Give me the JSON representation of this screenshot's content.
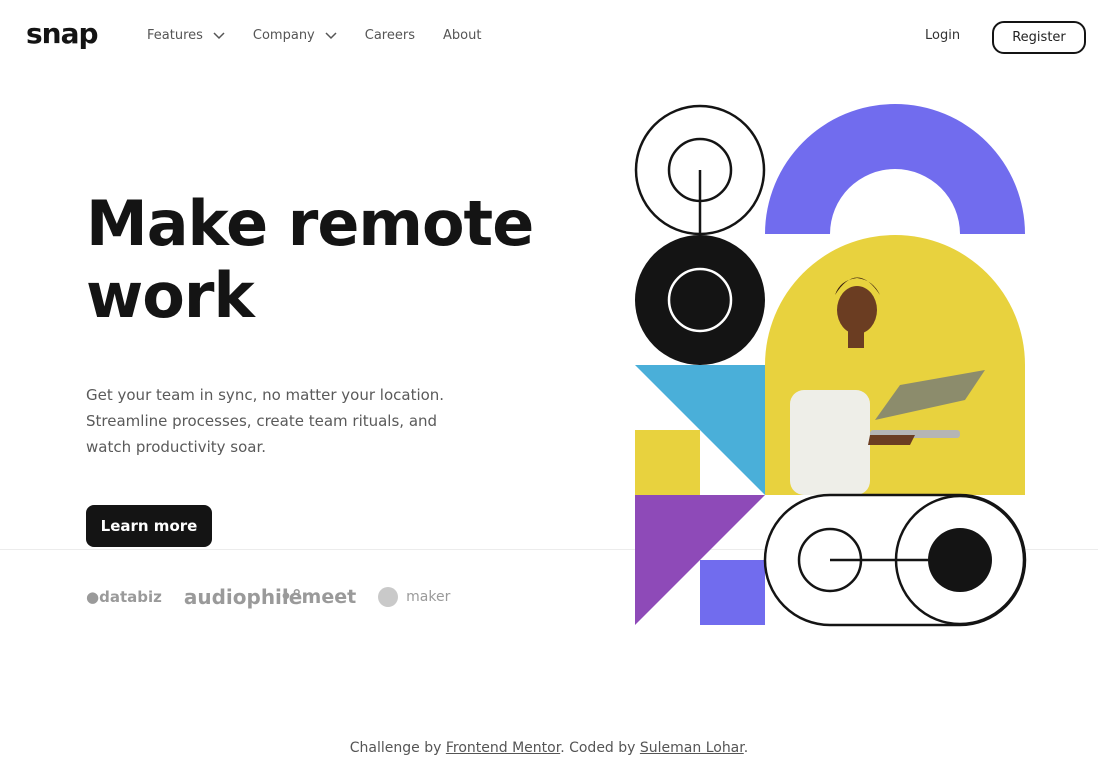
{
  "header": {
    "logo": "snap",
    "nav": [
      {
        "label": "Features",
        "has_dropdown": true
      },
      {
        "label": "Company",
        "has_dropdown": true
      },
      {
        "label": "Careers",
        "has_dropdown": false
      },
      {
        "label": "About",
        "has_dropdown": false
      }
    ],
    "login_label": "Login",
    "register_label": "Register"
  },
  "hero": {
    "headline": "Make remote work",
    "subtext": "Get your team in sync, no matter your location. Streamline processes, create team rituals, and watch productivity soar.",
    "cta_label": "Learn more"
  },
  "clients": [
    "databiz",
    "audiophile",
    "meet",
    "maker"
  ],
  "footer": {
    "prefix": "Challenge by ",
    "link1": "Frontend Mentor",
    "middle": ". Coded by ",
    "link2": "Suleman Lohar",
    "suffix": "."
  },
  "colors": {
    "purple": "#716cee",
    "yellow": "#e8d23e",
    "blue": "#4aafd9",
    "violet": "#8e4ab8",
    "dark": "#141414"
  }
}
